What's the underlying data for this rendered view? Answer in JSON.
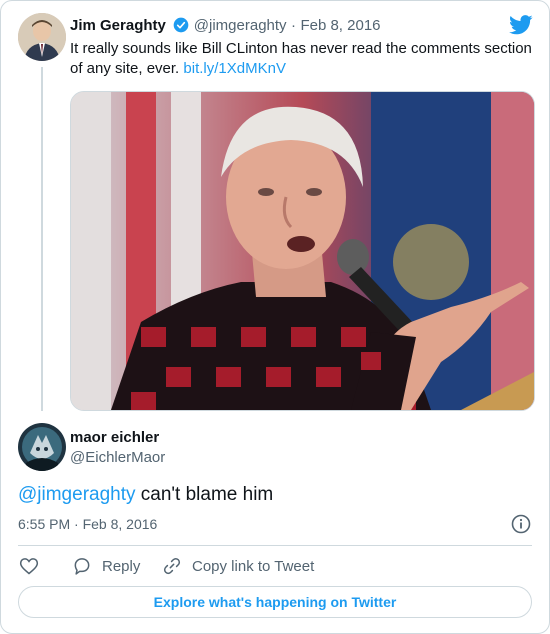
{
  "parent_tweet": {
    "author_name": "Jim Geraghty",
    "handle": "@jimgeraghty",
    "separator": "·",
    "date": "Feb 8, 2016",
    "text": "It really sounds like Bill CLinton has never read the comments section of any site, ever.",
    "link": "bit.ly/1XdMKnV"
  },
  "reply_tweet": {
    "author_name": "maor eichler",
    "handle": "@EichlerMaor",
    "mention": "@jimgeraghty",
    "text": "can't blame him",
    "time": "6:55 PM",
    "separator": "·",
    "date": "Feb 8, 2016"
  },
  "actions": {
    "reply_label": "Reply",
    "copy_link_label": "Copy link to Tweet"
  },
  "explore_button": "Explore what's happening on Twitter",
  "icons": {
    "brand": "twitter-bird-icon",
    "verified": "verified-badge-icon",
    "info": "info-icon",
    "like": "heart-icon",
    "reply": "reply-bubble-icon",
    "copy": "link-icon"
  },
  "colors": {
    "accent": "#1d9bf0",
    "secondary_text": "#536471",
    "border": "#cfd9de"
  }
}
